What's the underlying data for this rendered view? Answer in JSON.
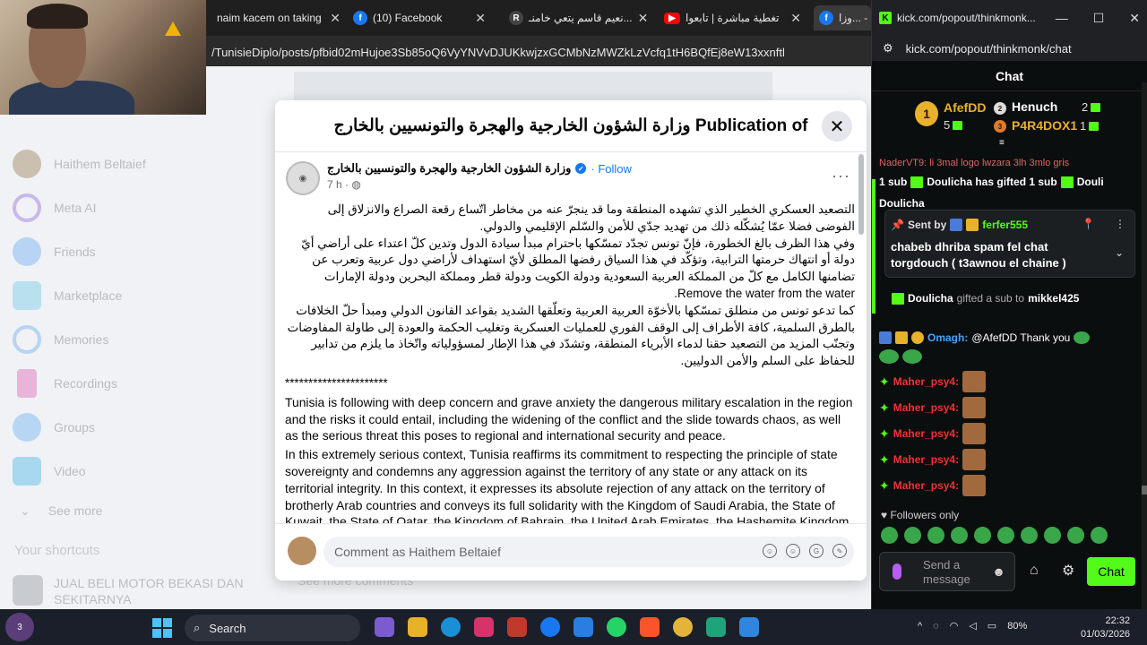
{
  "browser": {
    "tabs": [
      {
        "label": "naim kacem on taking",
        "icon": "generic-icon"
      },
      {
        "label": "(10) Facebook",
        "icon": "facebook-icon"
      },
      {
        "label": "نعيم قاسم يتعي خامنـ...",
        "icon": "reader-icon"
      },
      {
        "label": "تغطية مباشرة | تابعوا",
        "icon": "youtube-icon"
      },
      {
        "label": "وزا... -",
        "icon": "facebook-icon"
      }
    ],
    "url": "/TunisieDiplo/posts/pfbid02mHujoe3Sb85oQ6VyYNVvDJUKkwjzxGCMbNzMWZkLzVcfq1tH6BQfEj8eW13xxnftl"
  },
  "facebook_sidebar": {
    "items": [
      {
        "label": "Haithem Beltaief"
      },
      {
        "label": "Meta AI"
      },
      {
        "label": "Friends"
      },
      {
        "label": "Marketplace"
      },
      {
        "label": "Memories"
      },
      {
        "label": "Recordings"
      },
      {
        "label": "Groups"
      },
      {
        "label": "Video"
      }
    ],
    "see_more": "See more",
    "shortcuts_title": "Your shortcuts",
    "shortcut_item": "JUAL BELI MOTOR BEKASI DAN SEKITARNYA",
    "see_more_comments": "See more comments"
  },
  "modal": {
    "title": "Publication of وزارة الشؤون الخارجية والهجرة والتونسيين بالخارج",
    "close_icon": "close-icon",
    "author": "وزارة الشؤون الخارجية والهجرة والتونسيين بالخارج",
    "follow": "Follow",
    "time": "7 h ·",
    "more": "···",
    "ar_p1": "التصعيد العسكري الخطير الذي تشهده المنطقة وما قد ينجرّ عنه من مخاطر اتّساع رقعة الصراع والانزلاق إلى الفوضى فضلا عمّا يُشكّله ذلك من تهديد جدّي للأمن والسّلم الإقليمي والدولي.",
    "ar_p2": "وفي هذا الظرف بالغ الخطورة، فإنّ تونس تجدّد تمسّكها باحترام مبدأ سيادة الدول وتدين كلّ اعتداء على أراضي أيّ دولة أو انتهاك حرمتها الترابية، وتؤكّد في هذا السياق رفضها المطلق لأيّ استهداف لأراضي دول عربية وتعرب عن تضامنها الكامل مع كلّ من المملكة العربية السعودية ودولة الكويت ودولة قطر ومملكة البحرين ودولة الإمارات",
    "ar_p2_end": "Remove the water from the water.",
    "ar_p3": "كما تدعو تونس من منطلق تمسّكها بالأخوّة العربية العربية وتعلّقها الشديد بقواعد القانون الدولي ومبدأ حلّ الخلافات بالطرق السلمية، كافة الأطراف إلى الوقف الفوري للعمليات العسكرية وتغليب الحكمة والعودة إلى طاولة المفاوضات وتجنّب المزيد من التصعيد حقنا لدماء الأبرياء المنطقة، وتشدّد في هذا الإطار لمسؤولياته واتّخاذ ما يلزم من تدابير للحفاظ على السلم والأمن الدوليين.",
    "stars": "**********************",
    "en_p1": "Tunisia is following with deep concern and grave anxiety the dangerous military escalation in the region and the risks it could entail, including the widening of the conflict and the slide towards chaos, as well as the serious threat this poses to regional and international security and peace.",
    "en_p2": "In this extremely serious context, Tunisia reaffirms its commitment to respecting the principle of state sovereignty and condemns any aggression against the territory of any state or any attack on its territorial integrity. In this context, it expresses its absolute rejection of any attack on the territory of brotherly Arab countries and conveys its full solidarity with the Kingdom of Saudi Arabia, the State of Kuwait, the State of Qatar, the Kingdom of Bahrain, the United Arab Emirates, the Hashemite Kingdom",
    "comment_placeholder": "Comment as Haithem Beltaief"
  },
  "kick": {
    "window_title": "kick.com/popout/thinkmonk...",
    "url": "kick.com/popout/thinkmonk/chat",
    "header": "Chat",
    "leaders": [
      {
        "rank": "1",
        "name": "AfefDD",
        "count": "5",
        "color": "#e8b12a"
      },
      {
        "rank": "2",
        "name": "Henuch",
        "count": "2",
        "color": "#ffffff"
      },
      {
        "rank": "3",
        "name": "P4R4DOX1",
        "count": "1",
        "color": "#e8b12a"
      }
    ],
    "cut_name": "NaderVT9: li 3mal logo lwzara 3lh 3mlo gris",
    "gift_banner_a": "1 sub",
    "gift_banner_b": "Doulicha has gifted 1 sub",
    "gift_banner_c": "Douli",
    "pin_sent_by": "Sent by",
    "pin_user": "ferfer555",
    "pin_msg": "chabeb dhriba spam fel chat torgdouch ( t3awnou el chaine )",
    "behind_pin": "Doulicha",
    "gifted_user": "Doulicha",
    "gifted_mid": "gifted a sub to",
    "gifted_to": "mikkel425",
    "omagh_user": "Omagh:",
    "omagh_msg": "@AfefDD Thank you",
    "maher": "Maher_psy4:",
    "followers_only": "Followers only",
    "input_placeholder": "Send a message",
    "send": "Chat"
  },
  "taskbar": {
    "search": "Search",
    "weather_badge": "3",
    "battery": "80%",
    "time": "22:32",
    "date": "01/03/2026"
  }
}
